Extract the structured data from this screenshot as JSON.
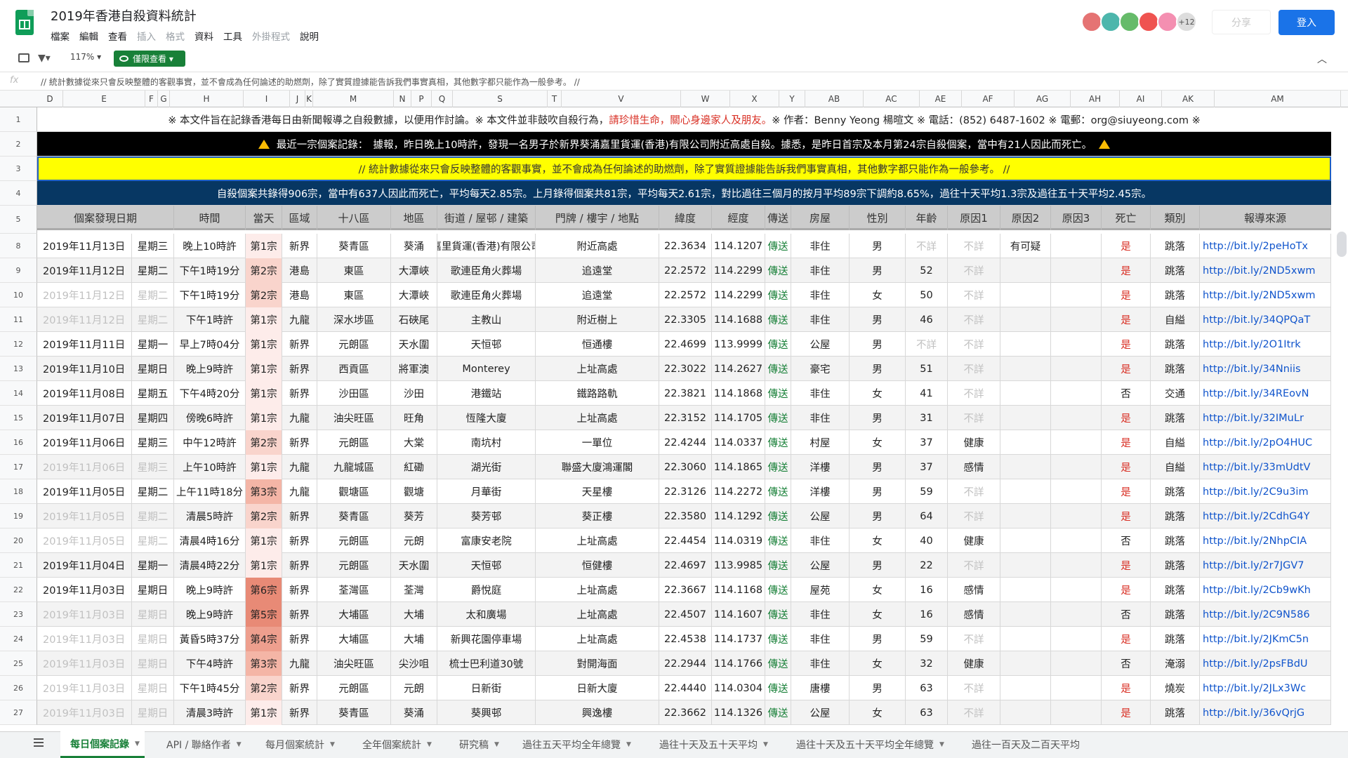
{
  "title": "2019年香港自殺資料統計",
  "menu": [
    "檔案",
    "編輯",
    "查看",
    "插入",
    "格式",
    "資料",
    "工具",
    "外掛程式",
    "說明"
  ],
  "menu_dim": [
    false,
    false,
    false,
    true,
    true,
    false,
    false,
    true,
    false
  ],
  "avatars": {
    "colors": [
      "#e57373",
      "#4db6ac",
      "#66bb6a",
      "#ef5350",
      "#f48fb1"
    ],
    "more": "+12"
  },
  "share_label": "分享",
  "login_label": "登入",
  "zoom": "117%",
  "view_only_label": "僅限查看",
  "formula": "// 統計數據從來只會反映整體的客觀事實，並不會成為任何論述的助燃劑，除了實質證據能告訴我們事實真相，其他數字都只能作為一般參考。 //",
  "column_letters": [
    "D",
    "E",
    "F",
    "G",
    "H",
    "I",
    "J",
    "K",
    "M",
    "N",
    "P",
    "Q",
    "S",
    "T",
    "V",
    "W",
    "X",
    "Y",
    "AB",
    "AC",
    "AE",
    "AF",
    "AG",
    "AH",
    "AI",
    "AK",
    "AM"
  ],
  "row_numbers": [
    "1",
    "2",
    "3",
    "4",
    "5",
    "8",
    "9",
    "10",
    "11",
    "12",
    "13",
    "14",
    "15",
    "16",
    "17",
    "18",
    "19",
    "20",
    "21",
    "22",
    "23",
    "24",
    "25",
    "26",
    "27"
  ],
  "info_row": {
    "a": "※ 本文件旨在記錄香港每日由新聞報導之自殺數據，以便用作討論。※ 本文件並非鼓吹自殺行為，",
    "red": "請珍惜生命，關心身邊家人及朋友。",
    "b": "※ 作者：Benny Yeong 楊暄文 ※ 電話：(852) 6487-1602 ※ 電郵：org@siuyeong.com ※"
  },
  "latest_record": "最近一宗個案記錄：　據報，昨日晚上10時許，發現一名男子於新界葵涌嘉里貨運(香港)有限公司附近高處自殺。據悉，是昨日首宗及本月第24宗自殺個案，當中有21人因此而死亡。",
  "disclaimer": "// 統計數據從來只會反映整體的客觀事實，並不會成為任何論述的助燃劑，除了實質證據能告訴我們事實真相，其他數字都只能作為一般參考。 //",
  "summary": "自殺個案共錄得906宗，當中有637人因此而死亡，平均每天2.85宗。上月錄得個案共81宗，平均每天2.61宗，對比過往三個月的按月平均89宗下調約8.65%，過往十天平均1.3宗及過往五十天平均2.45宗。",
  "headers": [
    "個案發現日期",
    "時間",
    "當天",
    "區域",
    "十八區",
    "地區",
    "街道 / 屋邨 / 建築",
    "門牌 / 樓宇 / 地點",
    "緯度",
    "經度",
    "傳送",
    "房屋",
    "性別",
    "年齡",
    "原因1",
    "原因2",
    "原因3",
    "死亡",
    "類別",
    "報導來源"
  ],
  "rows": [
    {
      "date": "2019年11月13日",
      "weekday": "星期三",
      "dim": false,
      "time": "晚上10時許",
      "nth": "第1宗",
      "shade": 0,
      "region": "新界",
      "district": "葵青區",
      "area": "葵涌",
      "street": "嘉里貨運(香港)有限公司",
      "place": "附近高處",
      "lat": "22.3634",
      "lng": "114.1207",
      "send": "傳送",
      "housing": "非住",
      "sex": "男",
      "age": "不詳",
      "r1": "不詳",
      "r2": "有可疑",
      "r3": "",
      "death": "是",
      "type": "跳落",
      "src": "http://bit.ly/2peHoTx"
    },
    {
      "date": "2019年11月12日",
      "weekday": "星期二",
      "dim": false,
      "time": "下午1時19分",
      "nth": "第2宗",
      "shade": 1,
      "region": "港島",
      "district": "東區",
      "area": "大潭峽",
      "street": "歌連臣角火葬場",
      "place": "追遠堂",
      "lat": "22.2572",
      "lng": "114.2299",
      "send": "傳送",
      "housing": "非住",
      "sex": "男",
      "age": "52",
      "r1": "不詳",
      "r2": "",
      "r3": "",
      "death": "是",
      "type": "跳落",
      "src": "http://bit.ly/2ND5xwm"
    },
    {
      "date": "2019年11月12日",
      "weekday": "星期二",
      "dim": true,
      "time": "下午1時19分",
      "nth": "第2宗",
      "shade": 1,
      "region": "港島",
      "district": "東區",
      "area": "大潭峽",
      "street": "歌連臣角火葬場",
      "place": "追遠堂",
      "lat": "22.2572",
      "lng": "114.2299",
      "send": "傳送",
      "housing": "非住",
      "sex": "女",
      "age": "50",
      "r1": "不詳",
      "r2": "",
      "r3": "",
      "death": "是",
      "type": "跳落",
      "src": "http://bit.ly/2ND5xwm"
    },
    {
      "date": "2019年11月12日",
      "weekday": "星期二",
      "dim": true,
      "time": "下午1時許",
      "nth": "第1宗",
      "shade": 0,
      "region": "九龍",
      "district": "深水埗區",
      "area": "石硤尾",
      "street": "主教山",
      "place": "附近樹上",
      "lat": "22.3305",
      "lng": "114.1688",
      "send": "傳送",
      "housing": "非住",
      "sex": "男",
      "age": "46",
      "r1": "不詳",
      "r2": "",
      "r3": "",
      "death": "是",
      "type": "自縊",
      "src": "http://bit.ly/34QPQaT"
    },
    {
      "date": "2019年11月11日",
      "weekday": "星期一",
      "dim": false,
      "time": "早上7時04分",
      "nth": "第1宗",
      "shade": 0,
      "region": "新界",
      "district": "元朗區",
      "area": "天水圍",
      "street": "天恒邨",
      "place": "恒通樓",
      "lat": "22.4699",
      "lng": "113.9999",
      "send": "傳送",
      "housing": "公屋",
      "sex": "男",
      "age": "不詳",
      "r1": "不詳",
      "r2": "",
      "r3": "",
      "death": "是",
      "type": "跳落",
      "src": "http://bit.ly/2O1Itrk"
    },
    {
      "date": "2019年11月10日",
      "weekday": "星期日",
      "dim": false,
      "time": "晚上9時許",
      "nth": "第1宗",
      "shade": 0,
      "region": "新界",
      "district": "西貢區",
      "area": "將軍澳",
      "street": "Monterey",
      "place": "上址高處",
      "lat": "22.3022",
      "lng": "114.2627",
      "send": "傳送",
      "housing": "豪宅",
      "sex": "男",
      "age": "51",
      "r1": "不詳",
      "r2": "",
      "r3": "",
      "death": "是",
      "type": "跳落",
      "src": "http://bit.ly/34Nniis"
    },
    {
      "date": "2019年11月08日",
      "weekday": "星期五",
      "dim": false,
      "time": "下午4時20分",
      "nth": "第1宗",
      "shade": 0,
      "region": "新界",
      "district": "沙田區",
      "area": "沙田",
      "street": "港鐵站",
      "place": "鐵路路軌",
      "lat": "22.3821",
      "lng": "114.1868",
      "send": "傳送",
      "housing": "非住",
      "sex": "女",
      "age": "41",
      "r1": "不詳",
      "r2": "",
      "r3": "",
      "death": "否",
      "type": "交通",
      "src": "http://bit.ly/34REovN"
    },
    {
      "date": "2019年11月07日",
      "weekday": "星期四",
      "dim": false,
      "time": "傍晚6時許",
      "nth": "第1宗",
      "shade": 0,
      "region": "九龍",
      "district": "油尖旺區",
      "area": "旺角",
      "street": "恆隆大廈",
      "place": "上址高處",
      "lat": "22.3152",
      "lng": "114.1705",
      "send": "傳送",
      "housing": "非住",
      "sex": "男",
      "age": "31",
      "r1": "不詳",
      "r2": "",
      "r3": "",
      "death": "是",
      "type": "跳落",
      "src": "http://bit.ly/32IMuLr"
    },
    {
      "date": "2019年11月06日",
      "weekday": "星期三",
      "dim": false,
      "time": "中午12時許",
      "nth": "第2宗",
      "shade": 1,
      "region": "新界",
      "district": "元朗區",
      "area": "大棠",
      "street": "南坑村",
      "place": "一單位",
      "lat": "22.4244",
      "lng": "114.0337",
      "send": "傳送",
      "housing": "村屋",
      "sex": "女",
      "age": "37",
      "r1": "健康",
      "r2": "",
      "r3": "",
      "death": "是",
      "type": "自縊",
      "src": "http://bit.ly/2pO4HUC"
    },
    {
      "date": "2019年11月06日",
      "weekday": "星期三",
      "dim": true,
      "time": "上午10時許",
      "nth": "第1宗",
      "shade": 0,
      "region": "九龍",
      "district": "九龍城區",
      "area": "紅磡",
      "street": "湖光街",
      "place": "聯盛大廈鴻運閣",
      "lat": "22.3060",
      "lng": "114.1865",
      "send": "傳送",
      "housing": "洋樓",
      "sex": "男",
      "age": "37",
      "r1": "感情",
      "r2": "",
      "r3": "",
      "death": "是",
      "type": "自縊",
      "src": "http://bit.ly/33mUdtV"
    },
    {
      "date": "2019年11月05日",
      "weekday": "星期二",
      "dim": false,
      "time": "上午11時18分",
      "nth": "第3宗",
      "shade": 2,
      "region": "九龍",
      "district": "觀塘區",
      "area": "觀塘",
      "street": "月華街",
      "place": "天星樓",
      "lat": "22.3126",
      "lng": "114.2272",
      "send": "傳送",
      "housing": "洋樓",
      "sex": "男",
      "age": "59",
      "r1": "不詳",
      "r2": "",
      "r3": "",
      "death": "是",
      "type": "跳落",
      "src": "http://bit.ly/2C9u3im"
    },
    {
      "date": "2019年11月05日",
      "weekday": "星期二",
      "dim": true,
      "time": "清晨5時許",
      "nth": "第2宗",
      "shade": 1,
      "region": "新界",
      "district": "葵青區",
      "area": "葵芳",
      "street": "葵芳邨",
      "place": "葵正樓",
      "lat": "22.3580",
      "lng": "114.1292",
      "send": "傳送",
      "housing": "公屋",
      "sex": "男",
      "age": "64",
      "r1": "不詳",
      "r2": "",
      "r3": "",
      "death": "是",
      "type": "跳落",
      "src": "http://bit.ly/2CdhG4Y"
    },
    {
      "date": "2019年11月05日",
      "weekday": "星期二",
      "dim": true,
      "time": "清晨4時16分",
      "nth": "第1宗",
      "shade": 0,
      "region": "新界",
      "district": "元朗區",
      "area": "元朗",
      "street": "富康安老院",
      "place": "上址高處",
      "lat": "22.4454",
      "lng": "114.0319",
      "send": "傳送",
      "housing": "非住",
      "sex": "女",
      "age": "40",
      "r1": "健康",
      "r2": "",
      "r3": "",
      "death": "否",
      "type": "跳落",
      "src": "http://bit.ly/2NhpCIA"
    },
    {
      "date": "2019年11月04日",
      "weekday": "星期一",
      "dim": false,
      "time": "清晨4時22分",
      "nth": "第1宗",
      "shade": 0,
      "region": "新界",
      "district": "元朗區",
      "area": "天水圍",
      "street": "天恒邨",
      "place": "恒健樓",
      "lat": "22.4697",
      "lng": "113.9985",
      "send": "傳送",
      "housing": "公屋",
      "sex": "男",
      "age": "22",
      "r1": "不詳",
      "r2": "",
      "r3": "",
      "death": "是",
      "type": "跳落",
      "src": "http://bit.ly/2r7JGV7"
    },
    {
      "date": "2019年11月03日",
      "weekday": "星期日",
      "dim": false,
      "time": "晚上9時許",
      "nth": "第6宗",
      "shade": 4,
      "region": "新界",
      "district": "荃灣區",
      "area": "荃灣",
      "street": "爵悅庭",
      "place": "上址高處",
      "lat": "22.3667",
      "lng": "114.1168",
      "send": "傳送",
      "housing": "屋苑",
      "sex": "女",
      "age": "16",
      "r1": "感情",
      "r2": "",
      "r3": "",
      "death": "是",
      "type": "跳落",
      "src": "http://bit.ly/2Cb9wKh"
    },
    {
      "date": "2019年11月03日",
      "weekday": "星期日",
      "dim": true,
      "time": "晚上9時許",
      "nth": "第5宗",
      "shade": 4,
      "region": "新界",
      "district": "大埔區",
      "area": "大埔",
      "street": "太和廣場",
      "place": "上址高處",
      "lat": "22.4507",
      "lng": "114.1607",
      "send": "傳送",
      "housing": "非住",
      "sex": "女",
      "age": "16",
      "r1": "感情",
      "r2": "",
      "r3": "",
      "death": "否",
      "type": "跳落",
      "src": "http://bit.ly/2C9N586"
    },
    {
      "date": "2019年11月03日",
      "weekday": "星期日",
      "dim": true,
      "time": "黃昏5時37分",
      "nth": "第4宗",
      "shade": 3,
      "region": "新界",
      "district": "大埔區",
      "area": "大埔",
      "street": "新興花園停車場",
      "place": "上址高處",
      "lat": "22.4538",
      "lng": "114.1737",
      "send": "傳送",
      "housing": "非住",
      "sex": "男",
      "age": "59",
      "r1": "不詳",
      "r2": "",
      "r3": "",
      "death": "是",
      "type": "跳落",
      "src": "http://bit.ly/2JKmC5n"
    },
    {
      "date": "2019年11月03日",
      "weekday": "星期日",
      "dim": true,
      "time": "下午4時許",
      "nth": "第3宗",
      "shade": 2,
      "region": "九龍",
      "district": "油尖旺區",
      "area": "尖沙咀",
      "street": "梳士巴利道30號",
      "place": "對開海面",
      "lat": "22.2944",
      "lng": "114.1766",
      "send": "傳送",
      "housing": "非住",
      "sex": "女",
      "age": "32",
      "r1": "健康",
      "r2": "",
      "r3": "",
      "death": "否",
      "type": "淹溺",
      "src": "http://bit.ly/2psFBdU"
    },
    {
      "date": "2019年11月03日",
      "weekday": "星期日",
      "dim": true,
      "time": "下午1時45分",
      "nth": "第2宗",
      "shade": 1,
      "region": "新界",
      "district": "元朗區",
      "area": "元朗",
      "street": "日新街",
      "place": "日新大廈",
      "lat": "22.4440",
      "lng": "114.0304",
      "send": "傳送",
      "housing": "唐樓",
      "sex": "男",
      "age": "63",
      "r1": "不詳",
      "r2": "",
      "r3": "",
      "death": "是",
      "type": "燒炭",
      "src": "http://bit.ly/2JLx3Wc"
    },
    {
      "date": "2019年11月03日",
      "weekday": "星期日",
      "dim": true,
      "time": "清晨3時許",
      "nth": "第1宗",
      "shade": 0,
      "region": "新界",
      "district": "葵青區",
      "area": "葵涌",
      "street": "葵興邨",
      "place": "興逸樓",
      "lat": "22.3662",
      "lng": "114.1326",
      "send": "傳送",
      "housing": "公屋",
      "sex": "女",
      "age": "63",
      "r1": "不詳",
      "r2": "",
      "r3": "",
      "death": "是",
      "type": "跳落",
      "src": "http://bit.ly/36vQrjG"
    }
  ],
  "sheet_tabs": [
    "每日個案記錄",
    "API / 聯絡作者",
    "每月個案統計",
    "全年個案統計",
    "研究稿",
    "過往五天平均全年總覽",
    "過往十天及五十天平均",
    "過往十天及五十天平均全年總覽",
    "過往一百天及二百天平均"
  ]
}
